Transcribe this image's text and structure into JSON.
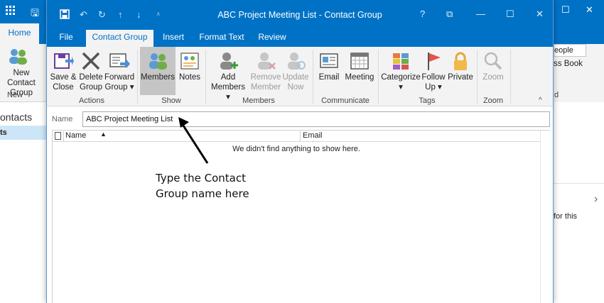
{
  "background": {
    "tabs": {
      "home": "Home"
    },
    "ribbon": {
      "new_contact_group": "New Contact Group",
      "new_group_label": "New",
      "people_search": "eople",
      "address_book": "ss Book",
      "group_d": "d"
    },
    "nav": {
      "contacts": "ontacts",
      "selected": "ts"
    },
    "reading": {
      "text": "for this"
    }
  },
  "window": {
    "title": "ABC Project Meeting List  -  Contact Group",
    "controls": {
      "help": "?",
      "restore": "⧉",
      "minimize": "—",
      "maximize": "☐",
      "close": "✕"
    }
  },
  "tabs": [
    "File",
    "Contact Group",
    "Insert",
    "Format Text",
    "Review"
  ],
  "ribbon": {
    "actions": {
      "save_close": [
        "Save &",
        "Close"
      ],
      "delete_group": [
        "Delete",
        "Group"
      ],
      "forward_group": [
        "Forward",
        "Group ▾"
      ],
      "label": "Actions"
    },
    "show": {
      "members": "Members",
      "notes": "Notes",
      "label": "Show"
    },
    "members": {
      "add": [
        "Add",
        "Members ▾"
      ],
      "remove": [
        "Remove",
        "Member"
      ],
      "update": [
        "Update",
        "Now"
      ],
      "label": "Members"
    },
    "communicate": {
      "email": "Email",
      "meeting": "Meeting",
      "label": "Communicate"
    },
    "tags": {
      "categorize": [
        "Categorize",
        "▾"
      ],
      "follow_up": [
        "Follow",
        "Up ▾"
      ],
      "private": "Private",
      "label": "Tags"
    },
    "zoom": {
      "zoom": "Zoom",
      "label": "Zoom"
    }
  },
  "form": {
    "name_label": "Name",
    "name_value": "ABC Project Meeting List"
  },
  "list": {
    "col_name": "Name",
    "col_email": "Email",
    "empty": "We didn't find anything to show here."
  },
  "annotation": {
    "line1": "Type the Contact",
    "line2": "Group name here"
  },
  "colors": {
    "accent": "#0072c6",
    "ribbon_bg": "#f3f3f3",
    "selected_btn": "#c5c5c5"
  }
}
